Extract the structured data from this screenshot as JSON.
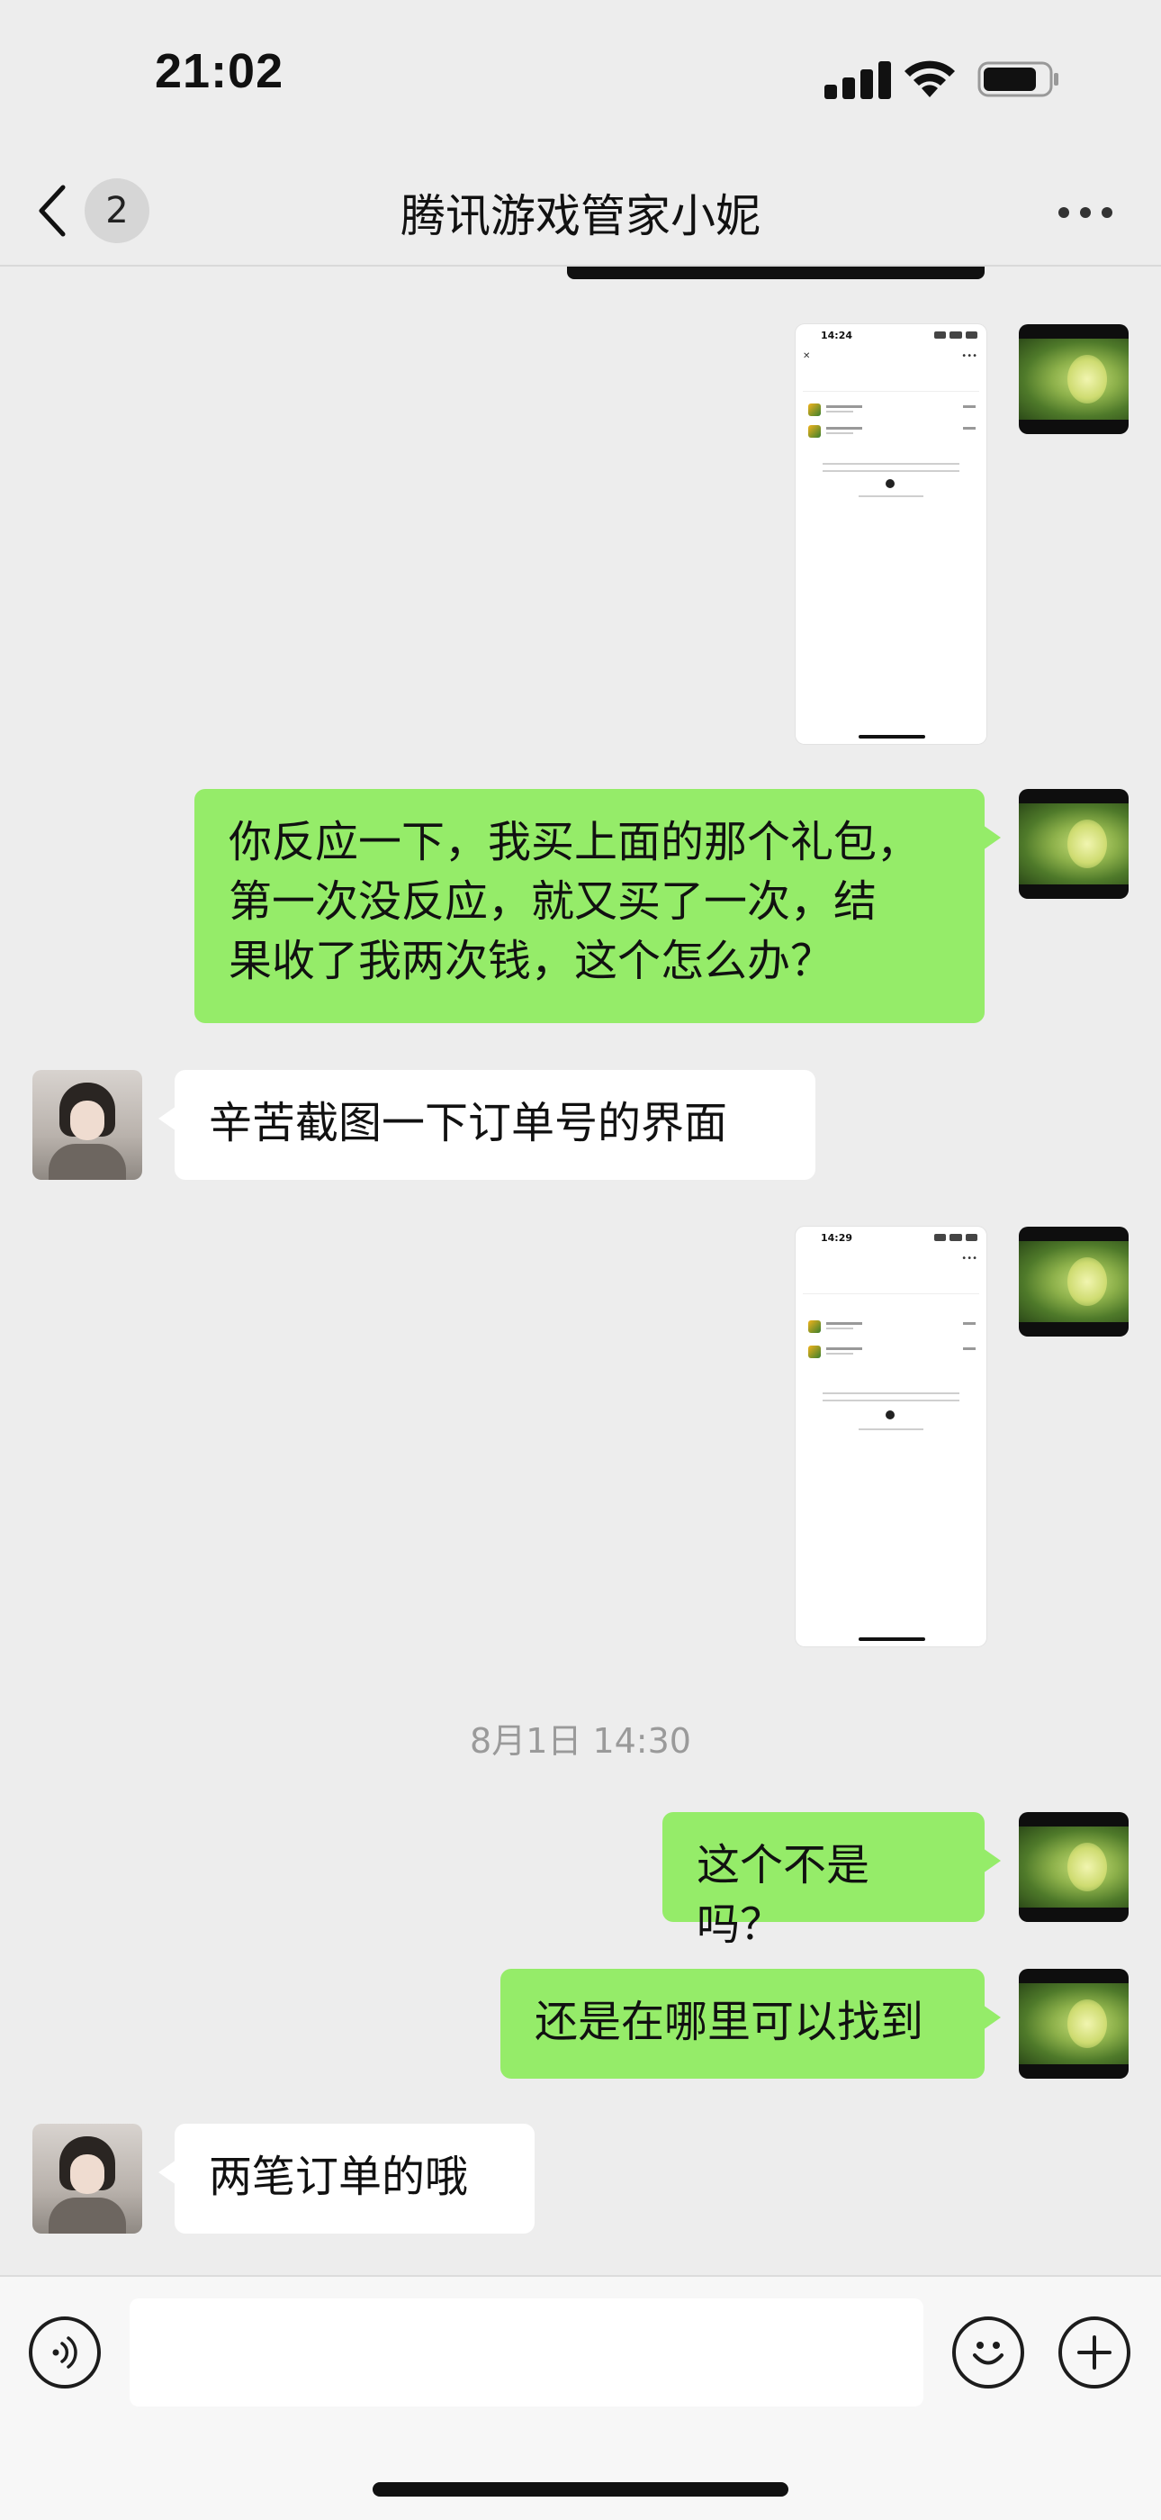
{
  "status": {
    "time": "21:02",
    "signal_icon": "cellular-signal-icon",
    "wifi_icon": "wifi-icon",
    "battery_icon": "battery-icon"
  },
  "nav": {
    "back_icon": "chevron-left-icon",
    "unread_count": "2",
    "title": "腾讯游戏管家小妮",
    "more_icon": "more-dots-icon"
  },
  "screenshot_a": {
    "time": "14:24"
  },
  "screenshot_b": {
    "time": "14:29"
  },
  "messages": [
    {
      "from": "self",
      "type": "image"
    },
    {
      "from": "self",
      "type": "text",
      "text": "你反应一下，我买上面的那个礼包，\n第一次没反应，就又买了一次，结\n果收了我两次钱，这个怎么办？"
    },
    {
      "from": "other",
      "type": "text",
      "text": "辛苦截图一下订单号的界面"
    },
    {
      "from": "self",
      "type": "image"
    },
    {
      "from": "self",
      "type": "text",
      "text": "这个不是吗？"
    },
    {
      "from": "self",
      "type": "text",
      "text": "还是在哪里可以找到"
    },
    {
      "from": "other",
      "type": "text",
      "text": "两笔订单的哦"
    }
  ],
  "timestamp": "8月1日 14:30",
  "input": {
    "voice_icon": "voice-input-icon",
    "emoji_icon": "emoji-icon",
    "plus_icon": "plus-icon",
    "value": ""
  },
  "colors": {
    "self_bubble": "#95ec69",
    "other_bubble": "#ffffff",
    "background": "#ededed"
  }
}
